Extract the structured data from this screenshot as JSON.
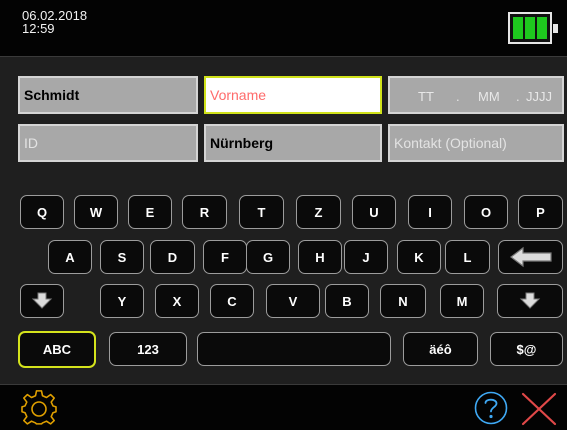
{
  "status": {
    "date": "06.02.2018",
    "time": "12:59",
    "battery_level": 1.0,
    "battery_color": "#1ec81e"
  },
  "form": {
    "last_name": "Schmidt",
    "first_name_placeholder": "Vorname",
    "date_parts": [
      "TT",
      ".",
      "MM",
      ".",
      "JJJJ"
    ],
    "id_placeholder": "ID",
    "city": "Nürnberg",
    "contact_placeholder": "Kontakt (Optional)",
    "accent_color": "#d0e21a",
    "placeholder_active_color": "#ff6b6b"
  },
  "keyboard": {
    "row1": [
      "Q",
      "W",
      "E",
      "R",
      "T",
      "Z",
      "U",
      "I",
      "O",
      "P"
    ],
    "row2": [
      "A",
      "S",
      "D",
      "F",
      "G",
      "H",
      "J",
      "K",
      "L"
    ],
    "row3": [
      "Y",
      "X",
      "C",
      "V",
      "B",
      "N",
      "M"
    ],
    "mode_abc": "ABC",
    "mode_123": "123",
    "mode_accents": "äéô",
    "mode_symbols": "$@",
    "icons": {
      "backspace": "backspace-arrow-icon",
      "shift_left": "shift-down-arrow-icon",
      "shift_right": "shift-down-arrow-icon"
    }
  },
  "footer": {
    "icons": [
      "gear-icon",
      "help-icon",
      "close-icon"
    ]
  }
}
